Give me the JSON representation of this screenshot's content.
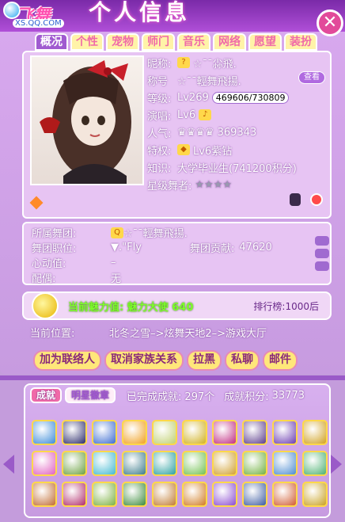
{
  "header": {
    "brand": "飞舞",
    "brand_sub": "XS.QQ.COM",
    "title": "个人信息",
    "close_glyph": "✕"
  },
  "tabs": [
    "概况",
    "个性",
    "宠物",
    "师门",
    "音乐",
    "网络",
    "愿望",
    "装扮"
  ],
  "profile": {
    "nickname_label": "昵称:",
    "nickname_value": "☆¯¯尛飛.",
    "title_label": "称号",
    "title_value": "☆¯¯輕舞飛揚.",
    "view_button": "查看",
    "level_label": "等级:",
    "level_value": "Lv269",
    "exp": "469606/730809",
    "sing_label": "演唱:",
    "sing_value": "Lv6",
    "pop_label": "人气:",
    "pop_value": "369343",
    "priv_label": "特权:",
    "priv_value": "Lv6紫钻",
    "know_label": "知识:",
    "know_value": "大学毕业生(741200积分)",
    "star_label": "星级舞者:",
    "stars": "★★★★"
  },
  "group": {
    "troupe_label": "所属舞团:",
    "troupe_value": "☆¯¯輕舞飛揚.",
    "role_label": "舞团职位:",
    "role_value": "▼.\"Fly",
    "contrib_label": "舞团贡献:",
    "contrib_value": "47620",
    "heart_label": "心动值:",
    "heart_value": "–",
    "spouse_label": "配偶:",
    "spouse_value": "无"
  },
  "charm": {
    "text": "当前魅力值:  魅力大使 640",
    "rank": "排行榜:1000后"
  },
  "location": {
    "label": "当前位置:",
    "value": "北冬之雪–>炫舞天地2–>游戏大厅"
  },
  "actions": [
    "加为联络人",
    "取消家族关系",
    "拉黑",
    "私聊",
    "邮件"
  ],
  "achievements": {
    "tab_done": "成就",
    "tab_star": "明星徽章",
    "done_label": "已完成成就:",
    "done_value": "297个",
    "score_label": "成就积分:",
    "score_value": "33773",
    "colors": [
      "#3a8ad8",
      "#2a2a6a",
      "#3a6ad0",
      "#f0a020",
      "#c0d070",
      "#d0b020",
      "#c02a80",
      "#5a3a8a",
      "#6a3ab0",
      "#d0a020",
      "#e060c0",
      "#6aa040",
      "#40b8d0",
      "#3a7a8a",
      "#2aa0a0",
      "#70c050",
      "#d0a030",
      "#70b040",
      "#4a8ad0",
      "#4ab070",
      "#c06a30",
      "#b02a6a",
      "#7ab040",
      "#3a8a3a",
      "#c07a30",
      "#d07a20",
      "#8a4ad0",
      "#3a5aa0",
      "#d05a30",
      "#c8a020"
    ]
  }
}
